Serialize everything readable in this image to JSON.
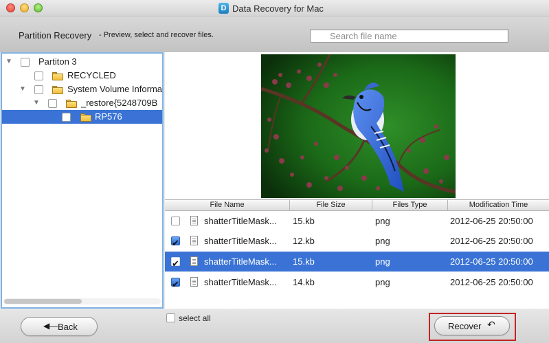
{
  "window": {
    "title": "Data Recovery for Mac",
    "logo_letter": "D",
    "controls": [
      "close-button",
      "minimize-button",
      "zoom-button"
    ]
  },
  "header": {
    "title": "Partition Recovery",
    "subtitle": "- Preview, select and recover files.",
    "search_placeholder": "Search file name"
  },
  "tree": {
    "items": [
      {
        "label": "Partiton 3",
        "expanded": true,
        "has_folder": false,
        "selected": false
      },
      {
        "label": "RECYCLED",
        "expanded": false,
        "has_folder": true,
        "selected": false
      },
      {
        "label": "System Volume Information",
        "expanded": true,
        "has_folder": true,
        "selected": false
      },
      {
        "label": "_restore{5248709B",
        "expanded": true,
        "has_folder": true,
        "selected": false
      },
      {
        "label": "RP576",
        "expanded": false,
        "has_folder": true,
        "selected": true
      }
    ]
  },
  "preview": {
    "image": "blue jay bird on flowering branch with green background"
  },
  "table": {
    "columns": [
      "File Name",
      "File Size",
      "Files Type",
      "Modification Time"
    ],
    "rows": [
      {
        "checked": false,
        "name": "shatterTitleMask...",
        "size": "15.kb",
        "type": "png",
        "modified": "2012-06-25 20:50:00",
        "selected": false
      },
      {
        "checked": true,
        "name": "shatterTitleMask...",
        "size": "12.kb",
        "type": "png",
        "modified": "2012-06-25 20:50:00",
        "selected": false
      },
      {
        "checked": true,
        "name": "shatterTitleMask...",
        "size": "15.kb",
        "type": "png",
        "modified": "2012-06-25 20:50:00",
        "selected": true
      },
      {
        "checked": true,
        "name": "shatterTitleMask...",
        "size": "14.kb",
        "type": "png",
        "modified": "2012-06-25 20:50:00",
        "selected": false
      }
    ]
  },
  "footer": {
    "back_label": "Back",
    "back_icon": "left-arrow-icon",
    "select_all_label": "select all",
    "recover_label": "Recover",
    "recover_icon": "undo-arrow-icon"
  },
  "colors": {
    "selection": "#3a73d5",
    "tree_border": "#7fb2e5",
    "highlight_frame": "#c62222"
  }
}
